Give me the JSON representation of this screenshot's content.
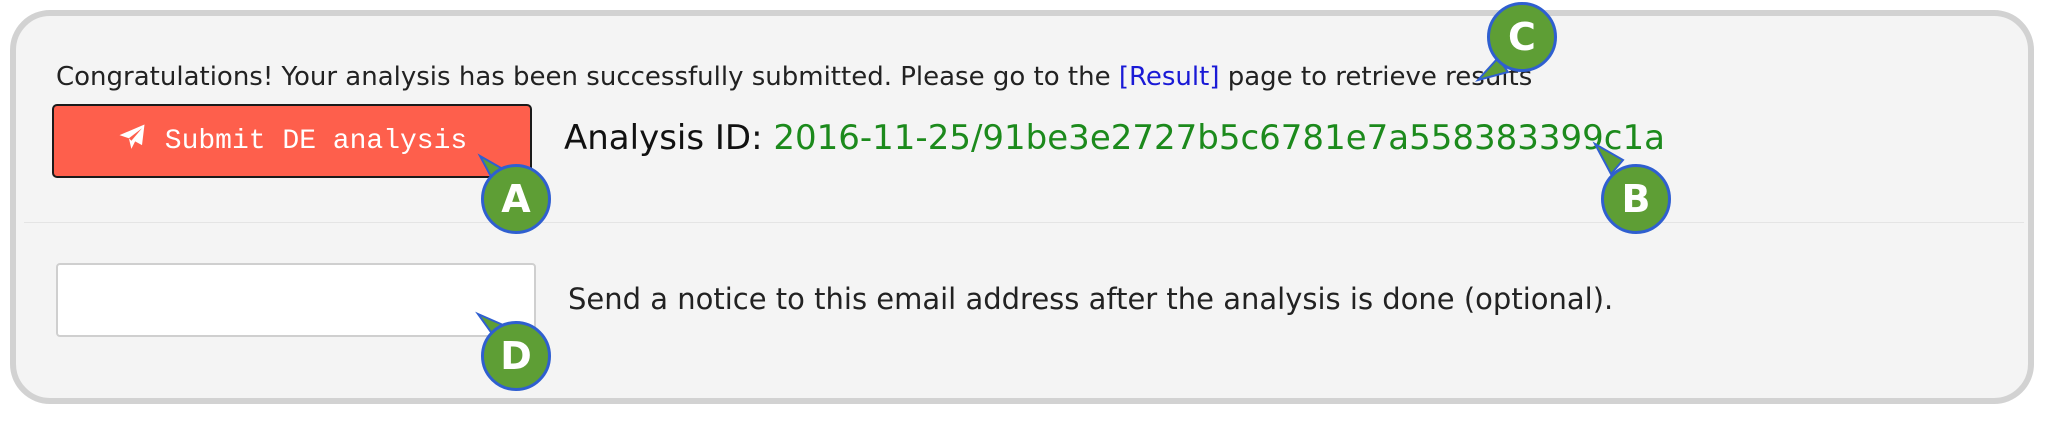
{
  "notice": {
    "text_before": "Congratulations! Your analysis has been successfully submitted. Please go to the ",
    "link_text": "[Result]",
    "text_after": " page to retrieve results"
  },
  "submit_button": {
    "label": "Submit DE analysis",
    "icon": "paper-plane-icon"
  },
  "analysis": {
    "label": "Analysis ID: ",
    "id": "2016-11-25/91be3e2727b5c6781e7a558383399c1a"
  },
  "email": {
    "value": "",
    "placeholder": "",
    "help": "Send a notice to this email address after the analysis is done (optional)."
  },
  "callouts": {
    "a": "A",
    "b": "B",
    "c": "C",
    "d": "D"
  },
  "colors": {
    "button_bg": "#fe5f4c",
    "analysis_id": "#1c8a1c",
    "link": "#1a1ad6",
    "callout_fill": "#5e9e35",
    "callout_border": "#2f5fd0"
  }
}
